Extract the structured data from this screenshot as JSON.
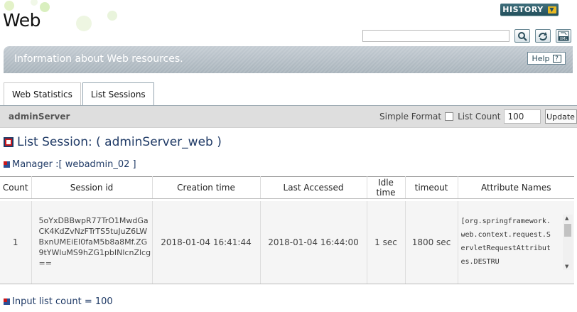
{
  "header": {
    "title": "Web",
    "history_label": "HISTORY",
    "search": {
      "value": "",
      "placeholder": ""
    },
    "tool_icons": [
      "search-icon",
      "refresh-icon",
      "xml-export-icon"
    ]
  },
  "banner": {
    "text": "Information about Web resources.",
    "help_label": "Help",
    "help_icon_text": "?"
  },
  "tabs": [
    {
      "label": "Web Statistics",
      "active": false
    },
    {
      "label": "List Sessions",
      "active": true
    }
  ],
  "server_bar": {
    "server_name": "adminServer",
    "simple_format_label": "Simple Format",
    "simple_format_checked": false,
    "list_count_label": "List Count",
    "list_count_value": "100",
    "update_label": "Update"
  },
  "section": {
    "title": "List Session: ( adminServer_web )",
    "manager": "Manager :[ webadmin_02 ]"
  },
  "table": {
    "columns": [
      "Count",
      "Session id",
      "Creation time",
      "Last Accessed",
      "Idle time",
      "timeout",
      "Attribute Names"
    ],
    "rows": [
      {
        "count": "1",
        "session_id": "5oYxDBBwpR77TrO1MwdGaCK4KdZvNzFTrTS5tuJuZ6LWBxnUMEiEI0faM5b8a8Mf.ZG9tYWluMS9hZG1pbINlcnZlcg==",
        "creation_time": "2018-01-04 16:41:44",
        "last_accessed": "2018-01-04 16:44:00",
        "idle_time": "1 sec",
        "timeout": "1800 sec",
        "attribute_names": "[org.springframework.web.context.request.ServletRequestAttributes.DESTRU"
      }
    ]
  },
  "footer": {
    "text": "Input list count = 100"
  }
}
